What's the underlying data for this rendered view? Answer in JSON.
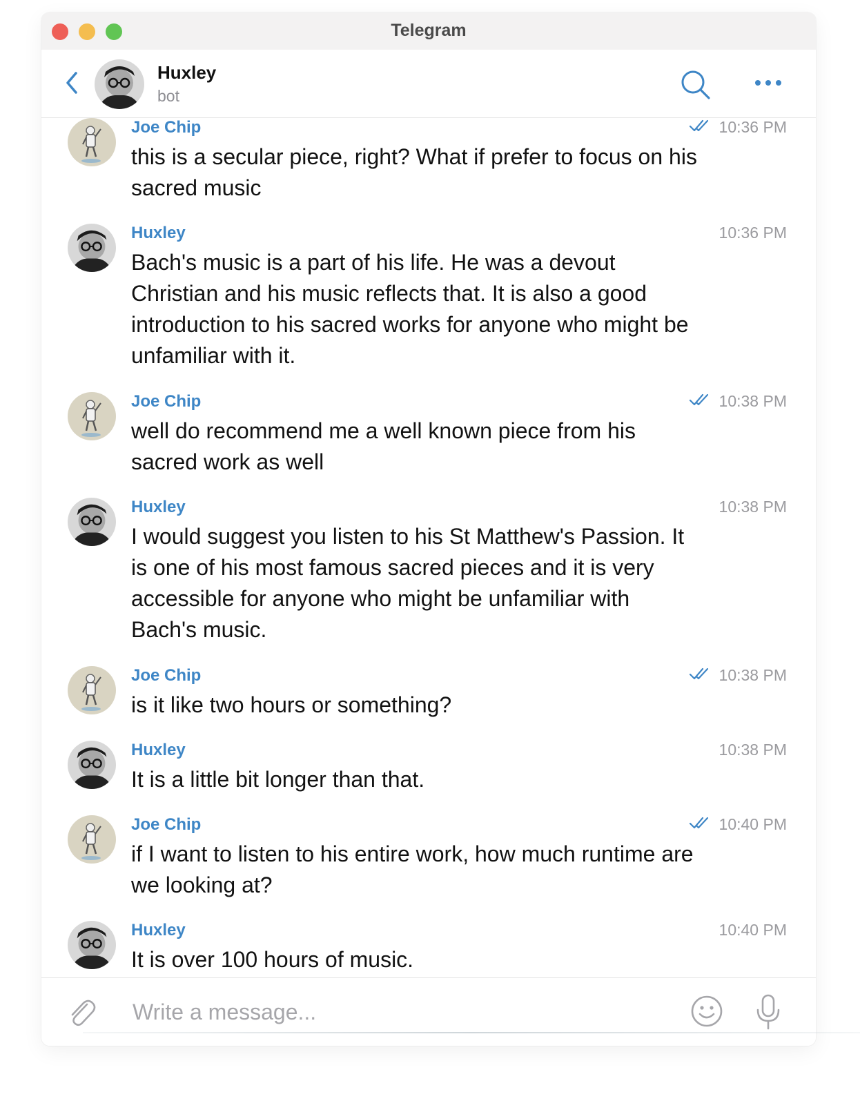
{
  "window": {
    "title": "Telegram"
  },
  "header": {
    "name": "Huxley",
    "status": "bot"
  },
  "messages": [
    {
      "sender": "Joe Chip",
      "time": "10:36 PM",
      "read": true,
      "avatar": "joe-chip-avatar",
      "text": "this is a secular piece, right? What if prefer to focus on his sacred music"
    },
    {
      "sender": "Huxley",
      "time": "10:36 PM",
      "read": false,
      "avatar": "huxley-avatar",
      "text": "Bach's music is a part of his life. He was a devout Christian and his music reflects that. It is also a good introduction to his sacred works for anyone who might be unfamiliar with it."
    },
    {
      "sender": "Joe Chip",
      "time": "10:38 PM",
      "read": true,
      "avatar": "joe-chip-avatar",
      "text": "well do recommend me a well known piece from his sacred work as well"
    },
    {
      "sender": "Huxley",
      "time": "10:38 PM",
      "read": false,
      "avatar": "huxley-avatar",
      "text": "I would suggest you listen to his St Matthew's Passion. It is one of his most famous sacred pieces and it is very accessible for anyone who might be unfamiliar with Bach's music."
    },
    {
      "sender": "Joe Chip",
      "time": "10:38 PM",
      "read": true,
      "avatar": "joe-chip-avatar",
      "text": "is it like two hours or something?"
    },
    {
      "sender": "Huxley",
      "time": "10:38 PM",
      "read": false,
      "avatar": "huxley-avatar",
      "text": "It is a little bit longer than that."
    },
    {
      "sender": "Joe Chip",
      "time": "10:40 PM",
      "read": true,
      "avatar": "joe-chip-avatar",
      "text": "if I want to listen to his entire work, how much runtime are we looking at?"
    },
    {
      "sender": "Huxley",
      "time": "10:40 PM",
      "read": false,
      "avatar": "huxley-avatar",
      "text": "It is over 100 hours of music."
    }
  ],
  "composer": {
    "placeholder": "Write a message...",
    "value": ""
  },
  "colors": {
    "accent": "#3e86c6",
    "sender_name": "#3e86c6",
    "timestamp": "#9a9a9e",
    "text": "#121212"
  }
}
